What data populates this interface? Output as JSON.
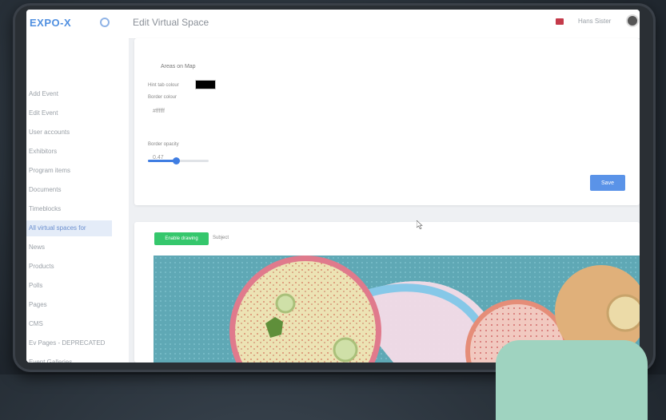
{
  "app": {
    "logo": "EXPO-X",
    "page_title": "Edit Virtual Space",
    "username": "Hans Sister"
  },
  "sidebar": {
    "items": [
      {
        "label": "Add Event",
        "active": false
      },
      {
        "label": "Edit Event",
        "active": false
      },
      {
        "label": "User accounts",
        "active": false
      },
      {
        "label": "Exhibitors",
        "active": false
      },
      {
        "label": "Program items",
        "active": false
      },
      {
        "label": "Documents",
        "active": false
      },
      {
        "label": "Timeblocks",
        "active": false
      },
      {
        "label": "All virtual spaces for",
        "active": true
      },
      {
        "label": "News",
        "active": false
      },
      {
        "label": "Products",
        "active": false
      },
      {
        "label": "Polls",
        "active": false
      },
      {
        "label": "Pages",
        "active": false
      },
      {
        "label": "CMS",
        "active": false
      },
      {
        "label": "Ev Pages - DEPRECATED",
        "active": false
      },
      {
        "label": "Event Galleries",
        "active": false
      }
    ]
  },
  "settings_card": {
    "heading": "Areas on Map",
    "hint_color_label": "Hint tab colour",
    "hint_color_value": "#000000",
    "border_colour_label": "Border colour",
    "border_colour_value": "#ffffff",
    "border_opacity_label": "Border opacity",
    "border_opacity_value": "0.47",
    "slider_fraction": 0.47,
    "save_label": "Save"
  },
  "map_card": {
    "enable_button": "Enable drawing",
    "select_label": "Subject"
  },
  "colors": {
    "accent": "#5a93e8",
    "green": "#35c76c",
    "map_background": "#5fa8b5"
  }
}
